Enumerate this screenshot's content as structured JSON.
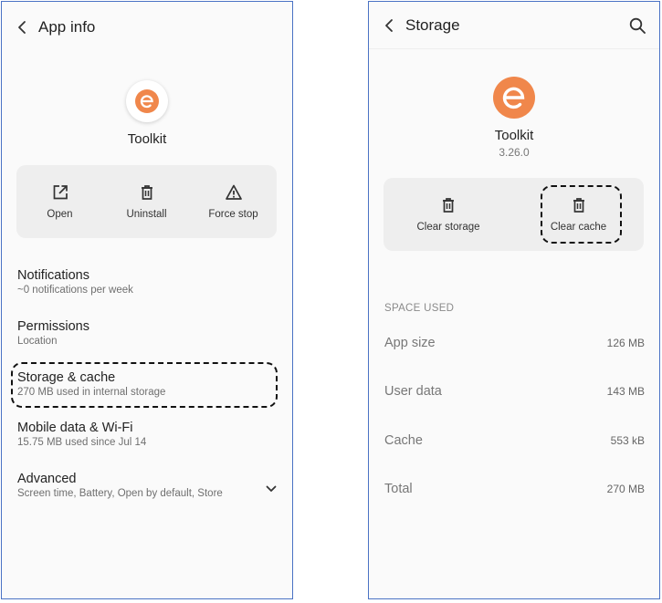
{
  "left_screen": {
    "title": "App info",
    "app_name": "Toolkit",
    "actions": [
      {
        "label": "Open",
        "icon": "open-external-icon"
      },
      {
        "label": "Uninstall",
        "icon": "trash-icon"
      },
      {
        "label": "Force stop",
        "icon": "warning-icon"
      }
    ],
    "items": [
      {
        "title": "Notifications",
        "subtitle": "~0 notifications per week"
      },
      {
        "title": "Permissions",
        "subtitle": "Location"
      },
      {
        "title": "Storage & cache",
        "subtitle": "270 MB used in internal storage"
      },
      {
        "title": "Mobile data & Wi-Fi",
        "subtitle": "15.75 MB used since Jul 14"
      },
      {
        "title": "Advanced",
        "subtitle": "Screen time, Battery, Open by default, Store"
      }
    ]
  },
  "right_screen": {
    "title": "Storage",
    "app_name": "Toolkit",
    "app_version": "3.26.0",
    "actions": [
      {
        "label": "Clear storage",
        "icon": "trash-icon"
      },
      {
        "label": "Clear cache",
        "icon": "trash-icon"
      }
    ],
    "section_header": "SPACE USED",
    "rows": [
      {
        "label": "App size",
        "value": "126 MB"
      },
      {
        "label": "User data",
        "value": "143 MB"
      },
      {
        "label": "Cache",
        "value": "553 kB"
      },
      {
        "label": "Total",
        "value": "270 MB"
      }
    ]
  },
  "colors": {
    "accent_orange": "#f0874b",
    "frame_border": "#4a72c4",
    "card_bg": "#eeeeee",
    "screen_bg": "#fafafa"
  }
}
